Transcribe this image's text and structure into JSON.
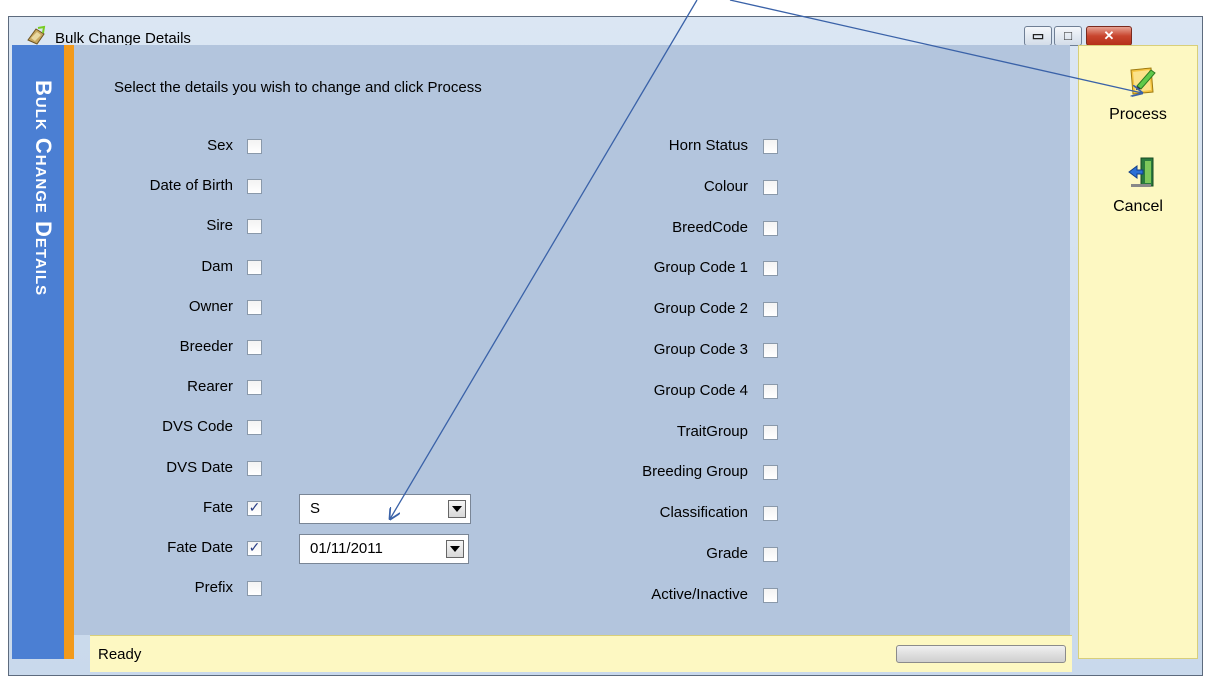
{
  "window": {
    "title": "Bulk Change Details",
    "minimize_glyph": "▭",
    "maximize_glyph": "□",
    "close_glyph": "✕"
  },
  "banner": {
    "text": "Bulk Change Details"
  },
  "instruction": "Select the details you wish to change and click Process",
  "left_fields": [
    {
      "label": "Sex",
      "checked": false
    },
    {
      "label": "Date of Birth",
      "checked": false
    },
    {
      "label": "Sire",
      "checked": false
    },
    {
      "label": "Dam",
      "checked": false
    },
    {
      "label": "Owner",
      "checked": false
    },
    {
      "label": "Breeder",
      "checked": false
    },
    {
      "label": "Rearer",
      "checked": false
    },
    {
      "label": "DVS Code",
      "checked": false
    },
    {
      "label": "DVS Date",
      "checked": false
    },
    {
      "label": "Fate",
      "checked": true
    },
    {
      "label": "Fate Date",
      "checked": true
    },
    {
      "label": "Prefix",
      "checked": false
    }
  ],
  "right_fields": [
    {
      "label": "Horn Status",
      "checked": false
    },
    {
      "label": "Colour",
      "checked": false
    },
    {
      "label": "BreedCode",
      "checked": false
    },
    {
      "label": "Group Code 1",
      "checked": false
    },
    {
      "label": "Group Code 2",
      "checked": false
    },
    {
      "label": "Group Code 3",
      "checked": false
    },
    {
      "label": "Group Code 4",
      "checked": false
    },
    {
      "label": "TraitGroup",
      "checked": false
    },
    {
      "label": "Breeding Group",
      "checked": false
    },
    {
      "label": "Classification",
      "checked": false
    },
    {
      "label": "Grade",
      "checked": false
    },
    {
      "label": "Active/Inactive",
      "checked": false
    }
  ],
  "fate_combo": {
    "value": "S"
  },
  "fate_date_combo": {
    "value": "01/11/2011"
  },
  "toolbar": {
    "process_label": "Process",
    "process_icon": "pencil-document-icon",
    "cancel_label": "Cancel",
    "cancel_icon": "exit-door-icon"
  },
  "status": {
    "text": "Ready",
    "progress": 1.0
  },
  "colors": {
    "banner": "#4b7fd3",
    "banner_stripe": "#f29a1b",
    "panel": "#b3c5dd",
    "toolbar": "#fdf8c2",
    "annotation_arrow": "#3a62a8"
  }
}
